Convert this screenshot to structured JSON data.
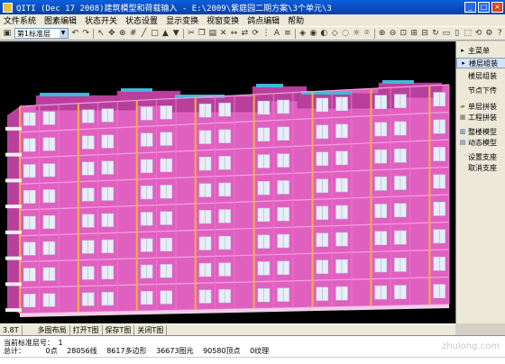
{
  "window": {
    "title": "QITI (Dec 17 2008)建筑模型和荷载输入 - E:\\2009\\紫庭园二期方案\\3个单元\\3"
  },
  "menu": [
    "文件系统",
    "图素编辑",
    "状态开关",
    "状态设置",
    "显示变换",
    "视窗变换",
    "鸽点编辑",
    "帮助"
  ],
  "toolbar": {
    "layer_value": "第1标准层",
    "icons": [
      "save-icon",
      "disk-icon",
      "undo-icon",
      "redo-icon",
      "cursor-icon",
      "pan-icon",
      "node-icon",
      "grid-icon",
      "line-icon",
      "box-icon",
      "zoom-in-icon",
      "zoom-out-icon",
      "rotate-icon",
      "view-icon",
      "layer-icon"
    ]
  },
  "right_panel": {
    "items": [
      {
        "label": "主菜单",
        "icon": "arrow-icon"
      },
      {
        "label": "楼层组装",
        "icon": "arrow-icon",
        "highlight": true
      },
      {
        "label": "楼层组装",
        "icon": ""
      },
      {
        "label": "节点下传",
        "icon": ""
      },
      {
        "label": "单层拼装",
        "icon": "assemble-icon"
      },
      {
        "label": "工程拼装",
        "icon": "project-icon"
      },
      {
        "label": "整楼模型",
        "icon": "building-icon"
      },
      {
        "label": "动态模型",
        "icon": "animation-icon"
      },
      {
        "label": "设置支座",
        "icon": ""
      },
      {
        "label": "取消支座",
        "icon": ""
      }
    ]
  },
  "tabs": [
    "3.8T",
    "多图布局",
    "打开T图",
    "保存T图",
    "关闭T图"
  ],
  "status": {
    "line1_label": "当前标准层号：",
    "line1_value": "1",
    "line2_label": "总计：",
    "points": "0点",
    "lines": "28056线",
    "polygons": "8617多边形",
    "elements": "36673图元",
    "vertices": "90580顶点",
    "textures": "0纹理"
  },
  "watermark": "zhulong.com",
  "colors": {
    "wall": "#e060c0",
    "wall_shade": "#b8409c",
    "window": "#e8eef8",
    "column": "#f0b040",
    "roof_accent": "#40b8d8"
  }
}
